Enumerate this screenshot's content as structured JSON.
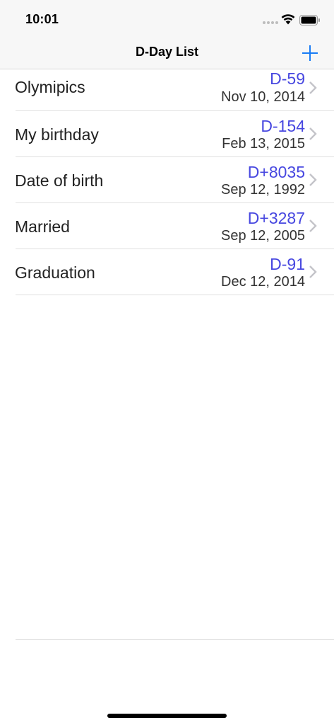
{
  "status_bar": {
    "time": "10:01",
    "signal_icon": "cellular-dots-icon",
    "wifi_icon": "wifi-icon",
    "battery_icon": "battery-icon"
  },
  "nav": {
    "title": "D-Day List",
    "add_icon": "plus-icon"
  },
  "accent_color": "#1a7cf5",
  "dday_color": "#4747e0",
  "items": [
    {
      "title": "Olymipics",
      "dday": "D-59",
      "date": "Nov 10, 2014"
    },
    {
      "title": "My birthday",
      "dday": "D-154",
      "date": "Feb 13, 2015"
    },
    {
      "title": "Date of birth",
      "dday": "D+8035",
      "date": "Sep 12, 1992"
    },
    {
      "title": "Married",
      "dday": "D+3287",
      "date": "Sep 12, 2005"
    },
    {
      "title": "Graduation",
      "dday": "D-91",
      "date": "Dec 12, 2014"
    }
  ]
}
